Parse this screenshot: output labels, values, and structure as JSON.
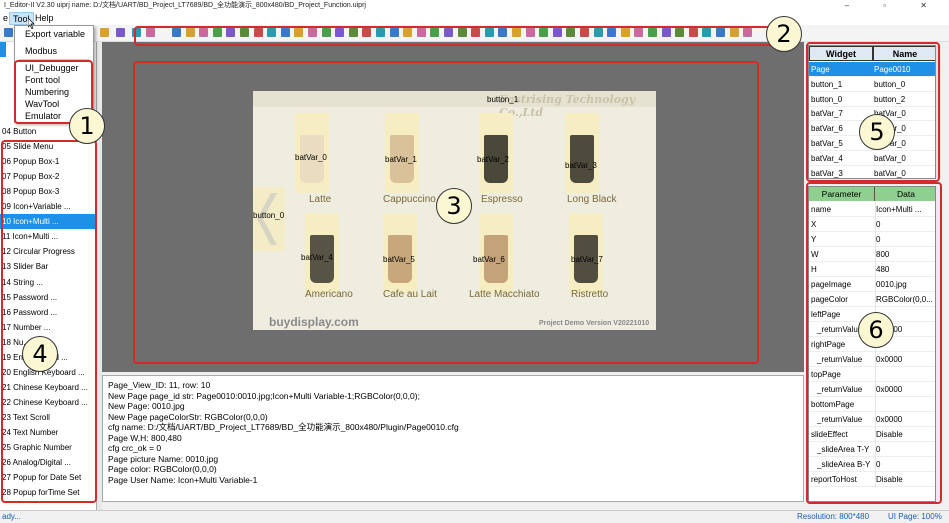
{
  "window": {
    "title": "I_Editor-II V2.30     uiprj name: D:/文档/UART/BD_Project_LT7689/BD_全功能演示_800x480/BD_Project_Function.uiprj",
    "controls": "–  ▫  ✕"
  },
  "menu": {
    "items": [
      {
        "label": "e"
      },
      {
        "label": "Tool"
      },
      {
        "label": "Help"
      }
    ]
  },
  "tool_menu": {
    "items": [
      "Export variable",
      "Modbus",
      "UI_Debugger",
      "Font tool",
      "Numbering",
      "WavTool",
      "Emulator"
    ]
  },
  "widget_list": {
    "items": [
      {
        "label": "04  Button"
      },
      {
        "label": "05  Slide Menu"
      },
      {
        "label": "06  Popup  Box-1"
      },
      {
        "label": "07  Popup  Box-2"
      },
      {
        "label": "08  Popup  Box-3"
      },
      {
        "label": "09  Icon+Variable ..."
      },
      {
        "label": "10  Icon+Multi ..."
      },
      {
        "label": "11  Icon+Multi ..."
      },
      {
        "label": "12  Circular Progress"
      },
      {
        "label": "13  Slider Bar"
      },
      {
        "label": "14  String ..."
      },
      {
        "label": "15  Password ..."
      },
      {
        "label": "16  Password ..."
      },
      {
        "label": "17  Number ..."
      },
      {
        "label": "18  Nu..."
      },
      {
        "label": "19  En...  ...board ..."
      },
      {
        "label": "20  English Keyboard ..."
      },
      {
        "label": "21  Chinese Keyboard ..."
      },
      {
        "label": "22  Chinese Keyboard ..."
      },
      {
        "label": "23  Text Scroll"
      },
      {
        "label": "24  Text Number"
      },
      {
        "label": "25  Graphic Number"
      },
      {
        "label": "26  Analog/Digital ..."
      },
      {
        "label": "27  Popup for Date Set"
      },
      {
        "label": "28  Popup forTime Set"
      }
    ]
  },
  "preview": {
    "header_text": "Eastrising Technology Co.,Ltd",
    "button_top": "button_1",
    "button_left": "button_0",
    "watermark": "buydisplay.com",
    "version": "Project Demo Version V20221010",
    "cups": [
      {
        "var": "batVar_0",
        "name": "Latte",
        "color": "#e9dcc0"
      },
      {
        "var": "batVar_1",
        "name": "Cappuccino",
        "color": "#d9c19a"
      },
      {
        "var": "batVar_2",
        "name": "Espresso",
        "color": "#4a4838"
      },
      {
        "var": "batVar_3",
        "name": "Long Black",
        "color": "#4e4b3c"
      },
      {
        "var": "batVar_4",
        "name": "Americano",
        "color": "#585445"
      },
      {
        "var": "batVar_5",
        "name": "Cafe au Lait",
        "color": "#c9a77c"
      },
      {
        "var": "batVar_6",
        "name": "Latte Macchiato",
        "color": "#c4a27a"
      },
      {
        "var": "batVar_7",
        "name": "Ristretto",
        "color": "#524e3f"
      }
    ]
  },
  "log": {
    "lines": [
      "Page_View_ID: 11, row: 10",
      "New Page page_id str: Page0010:0010.jpg;Icon+Multi Variable-1;RGBColor(0,0,0);",
      "New Page: 0010.jpg",
      "New Page pageColorStr: RGBColor(0,0,0)",
      "cfg name: D:/文档/UART/BD_Project_LT7689/BD_全功能演示_800x480/Plugin/Page0010.cfg",
      "Page W,H: 800,480",
      "cfg crc_ok = 0",
      "Page picture Name: 0010.jpg",
      "Page color: RGBColor(0,0,0)",
      "Page User Name: Icon+Multi Variable-1"
    ]
  },
  "widget_table": {
    "headers": [
      "Widget",
      "Name"
    ],
    "rows": [
      [
        "Page",
        "Page0010"
      ],
      [
        "button_1",
        "button_0"
      ],
      [
        "button_0",
        "button_2"
      ],
      [
        "batVar_7",
        "batVar_0"
      ],
      [
        "batVar_6",
        "batVar_0"
      ],
      [
        "batVar_5",
        "batVar_0"
      ],
      [
        "batVar_4",
        "batVar_0"
      ],
      [
        "batVar_3",
        "batVar_0"
      ]
    ]
  },
  "param_table": {
    "headers": [
      "Parameter",
      "Data"
    ],
    "rows": [
      [
        "name",
        "Icon+Multi ..."
      ],
      [
        "X",
        "0"
      ],
      [
        "Y",
        "0"
      ],
      [
        "W",
        "800"
      ],
      [
        "H",
        "480"
      ],
      [
        "pageImage",
        "0010.jpg"
      ],
      [
        "pageColor",
        "RGBColor(0,0..."
      ],
      [
        "leftPage",
        ""
      ],
      [
        "_returnValue",
        "0x0000"
      ],
      [
        "rightPage",
        ""
      ],
      [
        "_returnValue",
        "0x0000"
      ],
      [
        "topPage",
        ""
      ],
      [
        "_returnValue",
        "0x0000"
      ],
      [
        "bottomPage",
        ""
      ],
      [
        "_returnValue",
        "0x0000"
      ],
      [
        "slideEffect",
        "Disable"
      ],
      [
        "_slideArea T-Y",
        "0"
      ],
      [
        "_slideArea B-Y",
        "0"
      ],
      [
        "reportToHost",
        "Disable"
      ]
    ]
  },
  "status": {
    "left": "ady...",
    "resolution": "Resolution: 800*480",
    "ui_page": "UI Page: 100%"
  },
  "annotations": [
    "1",
    "2",
    "3",
    "4",
    "5",
    "6"
  ]
}
